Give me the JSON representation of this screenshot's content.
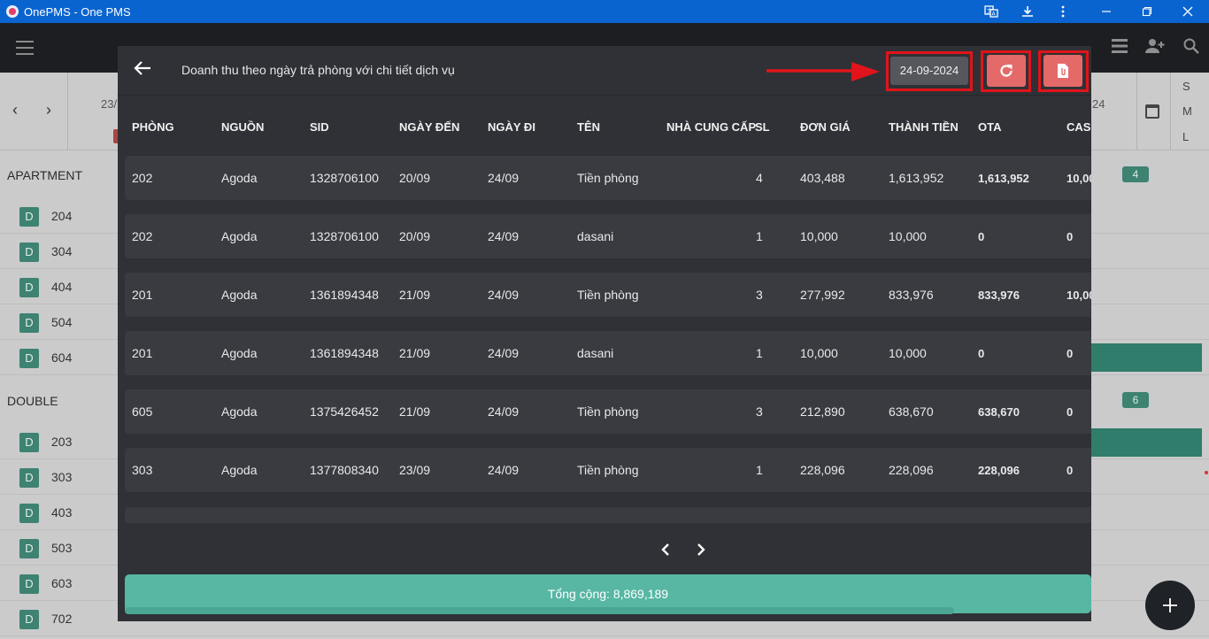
{
  "window": {
    "title": "OnePMS - One PMS"
  },
  "background": {
    "date_fragment_left": "23/",
    "date_fragment_right": "24",
    "sml": [
      "S",
      "M",
      "L"
    ],
    "groups": [
      {
        "label": "APARTMENT",
        "count": "4"
      },
      {
        "label": "DOUBLE",
        "count": "6"
      }
    ],
    "rooms_apartment": [
      {
        "type": "D",
        "number": "204"
      },
      {
        "type": "D",
        "number": "304"
      },
      {
        "type": "D",
        "number": "404"
      },
      {
        "type": "D",
        "number": "504"
      },
      {
        "type": "D",
        "number": "604"
      }
    ],
    "rooms_double": [
      {
        "type": "D",
        "number": "203"
      },
      {
        "type": "D",
        "number": "303"
      },
      {
        "type": "D",
        "number": "403"
      },
      {
        "type": "D",
        "number": "503"
      },
      {
        "type": "D",
        "number": "603"
      },
      {
        "type": "D",
        "number": "702"
      }
    ]
  },
  "modal": {
    "title": "Doanh thu theo ngày trả phòng với chi tiết dịch vụ",
    "date": "24-09-2024",
    "columns": [
      "PHÒNG",
      "NGUỒN",
      "SID",
      "NGÀY ĐẾN",
      "NGÀY ĐI",
      "TÊN",
      "NHÀ CUNG CẤP",
      "SL",
      "ĐƠN GIÁ",
      "THÀNH TIỀN",
      "OTA",
      "CASH"
    ],
    "rows": [
      [
        "202",
        "Agoda",
        "1328706100",
        "20/09",
        "24/09",
        "Tiền phòng",
        "",
        "4",
        "403,488",
        "1,613,952",
        "1,613,952",
        "10,00"
      ],
      [
        "202",
        "Agoda",
        "1328706100",
        "20/09",
        "24/09",
        "dasani",
        "",
        "1",
        "10,000",
        "10,000",
        "0",
        "0"
      ],
      [
        "201",
        "Agoda",
        "1361894348",
        "21/09",
        "24/09",
        "Tiền phòng",
        "",
        "3",
        "277,992",
        "833,976",
        "833,976",
        "10,00"
      ],
      [
        "201",
        "Agoda",
        "1361894348",
        "21/09",
        "24/09",
        "dasani",
        "",
        "1",
        "10,000",
        "10,000",
        "0",
        "0"
      ],
      [
        "605",
        "Agoda",
        "1375426452",
        "21/09",
        "24/09",
        "Tiền phòng",
        "",
        "3",
        "212,890",
        "638,670",
        "638,670",
        "0"
      ],
      [
        "303",
        "Agoda",
        "1377808340",
        "23/09",
        "24/09",
        "Tiền phòng",
        "",
        "1",
        "228,096",
        "228,096",
        "228,096",
        "0"
      ]
    ],
    "total": "Tổng cộng: 8,869,189"
  },
  "colors": {
    "accent_red": "#e46a6a",
    "highlight_red": "#e0141a",
    "teal": "#57b7a3"
  }
}
